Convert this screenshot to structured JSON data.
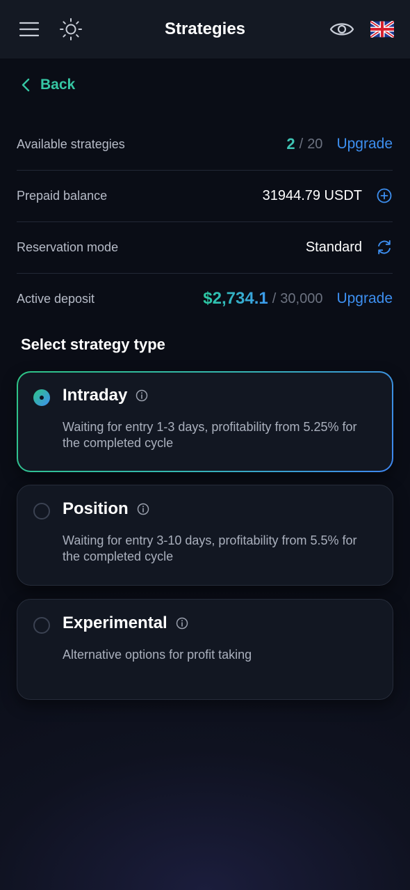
{
  "header": {
    "title": "Strategies",
    "icons": [
      "menu-icon",
      "sun-icon",
      "eye-icon",
      "uk-flag-icon"
    ]
  },
  "back": {
    "label": "Back"
  },
  "stats": {
    "available_strategies": {
      "label": "Available strategies",
      "used": "2",
      "separator": "/",
      "total": "20",
      "action": "Upgrade"
    },
    "prepaid_balance": {
      "label": "Prepaid balance",
      "value": "31944.79 USDT",
      "icon": "plus-circle-icon"
    },
    "reservation_mode": {
      "label": "Reservation mode",
      "value": "Standard",
      "icon": "refresh-icon"
    },
    "active_deposit": {
      "label": "Active deposit",
      "amount": "$2,734.1",
      "separator": "/",
      "limit": "30,000",
      "action": "Upgrade"
    }
  },
  "strategy_section": {
    "title": "Select strategy type",
    "options": [
      {
        "name": "Intraday",
        "description": "Waiting for entry 1-3 days, profitability from 5.25% for the completed cycle",
        "selected": true
      },
      {
        "name": "Position",
        "description": "Waiting for entry 3-10 days, profitability from 5.5% for the completed cycle",
        "selected": false
      },
      {
        "name": "Experimental",
        "description": "Alternative options for profit taking",
        "selected": false
      }
    ]
  },
  "colors": {
    "background": "#0a0d16",
    "header_bg": "#141923",
    "accent_green": "#36c7a4",
    "accent_blue": "#3d8ff0",
    "muted_text": "#b7bcc8"
  }
}
